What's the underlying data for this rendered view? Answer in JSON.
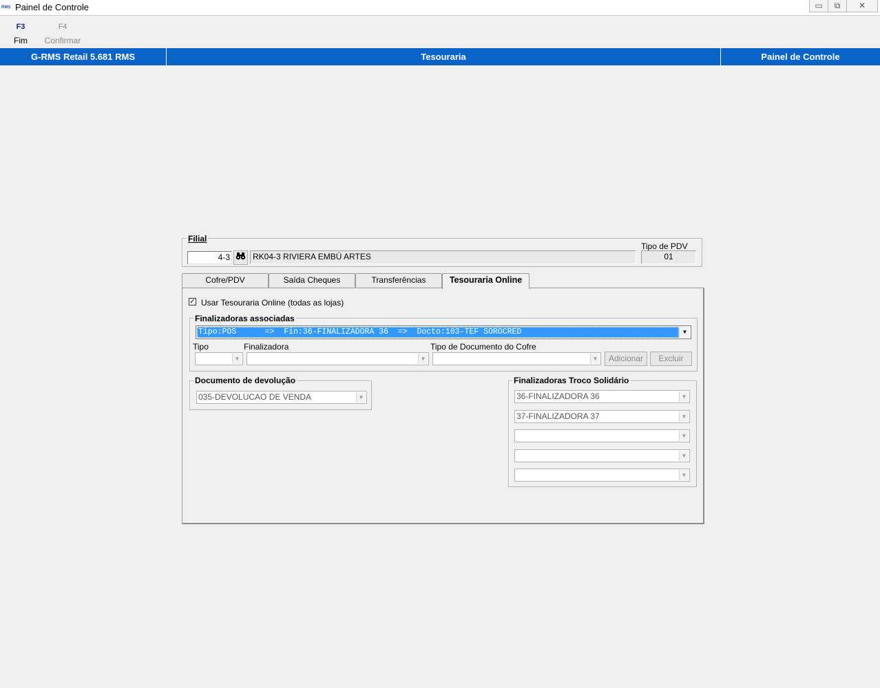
{
  "window": {
    "app_icon": "RMS",
    "title": "Painel de Controle",
    "buttons": [
      "minimize-icon",
      "restore-icon",
      "close-icon"
    ]
  },
  "toolbar": {
    "keys": [
      {
        "key": "F3",
        "label": "Fim",
        "enabled": true
      },
      {
        "key": "F4",
        "label": "Confirmar",
        "enabled": false
      }
    ]
  },
  "header": {
    "product": "G-RMS Retail 5.681 RMS",
    "module": "Tesouraria",
    "screen": "Painel de Controle"
  },
  "filial": {
    "label": "Filial",
    "code": "4-3",
    "search_icon": "binoculars-icon",
    "name": "RK04-3 RIVIERA EMBÚ ARTES",
    "tipo_pdv_label": "Tipo de PDV",
    "tipo_pdv_value": "01"
  },
  "tabs": [
    {
      "label": "Cofre/PDV",
      "active": false
    },
    {
      "label": "Saída Cheques",
      "active": false
    },
    {
      "label": "Transferências",
      "active": false
    },
    {
      "label": "Tesouraria Online",
      "active": true
    }
  ],
  "online": {
    "checkbox_label": "Usar Tesouraria Online (todas as lojas)",
    "checked": true,
    "finalizadoras": {
      "title": "Finalizadoras associadas",
      "selected": "Tipo:POS      =>  Fin:36-FINALIZADORA 36  =>  Docto:103-TEF SOROCRED",
      "tipo_label": "Tipo",
      "finalizadora_label": "Finalizadora",
      "tipo_doc_label": "Tipo de Documento do Cofre",
      "add_button": "Adicionar",
      "delete_button": "Excluir"
    },
    "devolucao": {
      "title": "Documento de devolução",
      "value": "035-DEVOLUCAO DE VENDA"
    },
    "troco": {
      "title": "Finalizadoras Troco Solidário",
      "items": [
        "36-FINALIZADORA 36",
        "37-FINALIZADORA 37",
        "",
        "",
        ""
      ]
    }
  },
  "colors": {
    "header_blue": "#0a64c8",
    "selection_blue": "#3399ff",
    "background": "#f0f0f0"
  }
}
